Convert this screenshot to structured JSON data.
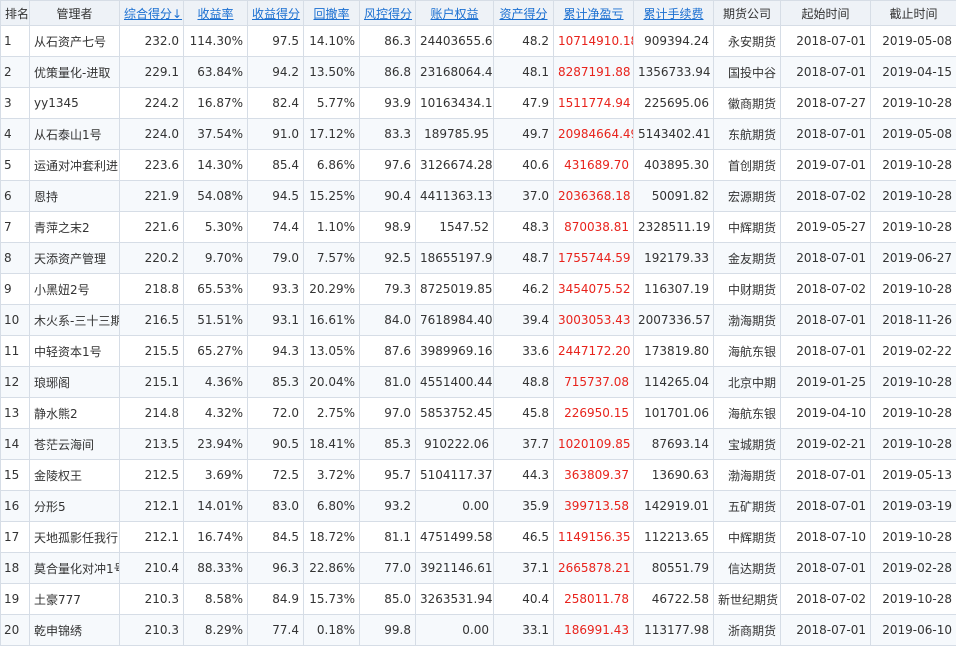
{
  "table": {
    "headers": [
      "排名",
      "管理者",
      "综合得分↓",
      "收益率",
      "收益得分",
      "回撤率",
      "风控得分",
      "账户权益",
      "资产得分",
      "累计净盈亏",
      "累计手续费",
      "期货公司",
      "起始时间",
      "截止时间"
    ],
    "rows": [
      {
        "rank": "1",
        "manager": "从石资产七号",
        "score": "232.0",
        "return_rate": "114.30%",
        "return_score": "97.5",
        "drawdown": "14.10%",
        "risk_score": "86.3",
        "equity": "24403655.63",
        "asset_score": "48.2",
        "net_pnl": "10714910.18",
        "fees": "909394.24",
        "broker": "永安期货",
        "start": "2018-07-01",
        "end": "2019-05-08"
      },
      {
        "rank": "2",
        "manager": "优策量化-进取",
        "score": "229.1",
        "return_rate": "63.84%",
        "return_score": "94.2",
        "drawdown": "13.50%",
        "risk_score": "86.8",
        "equity": "23168064.49",
        "asset_score": "48.1",
        "net_pnl": "8287191.88",
        "fees": "1356733.94",
        "broker": "国投中谷",
        "start": "2018-07-01",
        "end": "2019-04-15"
      },
      {
        "rank": "3",
        "manager": "yy1345",
        "score": "224.2",
        "return_rate": "16.87%",
        "return_score": "82.4",
        "drawdown": "5.77%",
        "risk_score": "93.9",
        "equity": "10163434.19",
        "asset_score": "47.9",
        "net_pnl": "1511774.94",
        "fees": "225695.06",
        "broker": "徽商期货",
        "start": "2018-07-27",
        "end": "2019-10-28"
      },
      {
        "rank": "4",
        "manager": "从石泰山1号",
        "score": "224.0",
        "return_rate": "37.54%",
        "return_score": "91.0",
        "drawdown": "17.12%",
        "risk_score": "83.3",
        "equity": "189785.95",
        "asset_score": "49.7",
        "net_pnl": "20984664.49",
        "fees": "5143402.41",
        "broker": "东航期货",
        "start": "2018-07-01",
        "end": "2019-05-08"
      },
      {
        "rank": "5",
        "manager": "运通对冲套利进",
        "score": "223.6",
        "return_rate": "14.30%",
        "return_score": "85.4",
        "drawdown": "6.86%",
        "risk_score": "97.6",
        "equity": "3126674.28",
        "asset_score": "40.6",
        "net_pnl": "431689.70",
        "fees": "403895.30",
        "broker": "首创期货",
        "start": "2019-07-01",
        "end": "2019-10-28"
      },
      {
        "rank": "6",
        "manager": "恩持",
        "score": "221.9",
        "return_rate": "54.08%",
        "return_score": "94.5",
        "drawdown": "15.25%",
        "risk_score": "90.4",
        "equity": "4411363.13",
        "asset_score": "37.0",
        "net_pnl": "2036368.18",
        "fees": "50091.82",
        "broker": "宏源期货",
        "start": "2018-07-02",
        "end": "2019-10-28"
      },
      {
        "rank": "7",
        "manager": "青萍之末2",
        "score": "221.6",
        "return_rate": "5.30%",
        "return_score": "74.4",
        "drawdown": "1.10%",
        "risk_score": "98.9",
        "equity": "1547.52",
        "asset_score": "48.3",
        "net_pnl": "870038.81",
        "fees": "2328511.19",
        "broker": "中辉期货",
        "start": "2019-05-27",
        "end": "2019-10-28"
      },
      {
        "rank": "8",
        "manager": "天添资产管理",
        "score": "220.2",
        "return_rate": "9.70%",
        "return_score": "79.0",
        "drawdown": "7.57%",
        "risk_score": "92.5",
        "equity": "18655197.95",
        "asset_score": "48.7",
        "net_pnl": "1755744.59",
        "fees": "192179.33",
        "broker": "金友期货",
        "start": "2018-07-01",
        "end": "2019-06-27"
      },
      {
        "rank": "9",
        "manager": "小黑妞2号",
        "score": "218.8",
        "return_rate": "65.53%",
        "return_score": "93.3",
        "drawdown": "20.29%",
        "risk_score": "79.3",
        "equity": "8725019.85",
        "asset_score": "46.2",
        "net_pnl": "3454075.52",
        "fees": "116307.19",
        "broker": "中财期货",
        "start": "2018-07-02",
        "end": "2019-10-28"
      },
      {
        "rank": "10",
        "manager": "木火系-三十三期",
        "score": "216.5",
        "return_rate": "51.51%",
        "return_score": "93.1",
        "drawdown": "16.61%",
        "risk_score": "84.0",
        "equity": "7618984.40",
        "asset_score": "39.4",
        "net_pnl": "3003053.43",
        "fees": "2007336.57",
        "broker": "渤海期货",
        "start": "2018-07-01",
        "end": "2018-11-26"
      },
      {
        "rank": "11",
        "manager": "中轻资本1号",
        "score": "215.5",
        "return_rate": "65.27%",
        "return_score": "94.3",
        "drawdown": "13.05%",
        "risk_score": "87.6",
        "equity": "3989969.16",
        "asset_score": "33.6",
        "net_pnl": "2447172.20",
        "fees": "173819.80",
        "broker": "海航东银",
        "start": "2018-07-01",
        "end": "2019-02-22"
      },
      {
        "rank": "12",
        "manager": "琅琊阁",
        "score": "215.1",
        "return_rate": "4.36%",
        "return_score": "85.3",
        "drawdown": "20.04%",
        "risk_score": "81.0",
        "equity": "4551400.44",
        "asset_score": "48.8",
        "net_pnl": "715737.08",
        "fees": "114265.04",
        "broker": "北京中期",
        "start": "2019-01-25",
        "end": "2019-10-28"
      },
      {
        "rank": "13",
        "manager": "静水熊2",
        "score": "214.8",
        "return_rate": "4.32%",
        "return_score": "72.0",
        "drawdown": "2.75%",
        "risk_score": "97.0",
        "equity": "5853752.45",
        "asset_score": "45.8",
        "net_pnl": "226950.15",
        "fees": "101701.06",
        "broker": "海航东银",
        "start": "2019-04-10",
        "end": "2019-10-28"
      },
      {
        "rank": "14",
        "manager": "苍茫云海间",
        "score": "213.5",
        "return_rate": "23.94%",
        "return_score": "90.5",
        "drawdown": "18.41%",
        "risk_score": "85.3",
        "equity": "910222.06",
        "asset_score": "37.7",
        "net_pnl": "1020109.85",
        "fees": "87693.14",
        "broker": "宝城期货",
        "start": "2019-02-21",
        "end": "2019-10-28"
      },
      {
        "rank": "15",
        "manager": "金陵权王",
        "score": "212.5",
        "return_rate": "3.69%",
        "return_score": "72.5",
        "drawdown": "3.72%",
        "risk_score": "95.7",
        "equity": "5104117.37",
        "asset_score": "44.3",
        "net_pnl": "363809.37",
        "fees": "13690.63",
        "broker": "渤海期货",
        "start": "2018-07-01",
        "end": "2019-05-13"
      },
      {
        "rank": "16",
        "manager": "分形5",
        "score": "212.1",
        "return_rate": "14.01%",
        "return_score": "83.0",
        "drawdown": "6.80%",
        "risk_score": "93.2",
        "equity": "0.00",
        "asset_score": "35.9",
        "net_pnl": "399713.58",
        "fees": "142919.01",
        "broker": "五矿期货",
        "start": "2018-07-01",
        "end": "2019-03-19"
      },
      {
        "rank": "17",
        "manager": "天地孤影任我行",
        "score": "212.1",
        "return_rate": "16.74%",
        "return_score": "84.5",
        "drawdown": "18.72%",
        "risk_score": "81.1",
        "equity": "4751499.58",
        "asset_score": "46.5",
        "net_pnl": "1149156.35",
        "fees": "112213.65",
        "broker": "中辉期货",
        "start": "2018-07-10",
        "end": "2019-10-28"
      },
      {
        "rank": "18",
        "manager": "莫合量化对冲1号",
        "score": "210.4",
        "return_rate": "88.33%",
        "return_score": "96.3",
        "drawdown": "22.86%",
        "risk_score": "77.0",
        "equity": "3921146.61",
        "asset_score": "37.1",
        "net_pnl": "2665878.21",
        "fees": "80551.79",
        "broker": "信达期货",
        "start": "2018-07-01",
        "end": "2019-02-28"
      },
      {
        "rank": "19",
        "manager": "土豪777",
        "score": "210.3",
        "return_rate": "8.58%",
        "return_score": "84.9",
        "drawdown": "15.73%",
        "risk_score": "85.0",
        "equity": "3263531.94",
        "asset_score": "40.4",
        "net_pnl": "258011.78",
        "fees": "46722.58",
        "broker": "新世纪期货",
        "start": "2018-07-02",
        "end": "2019-10-28"
      },
      {
        "rank": "20",
        "manager": "乾申锦绣",
        "score": "210.3",
        "return_rate": "8.29%",
        "return_score": "77.4",
        "drawdown": "0.18%",
        "risk_score": "99.8",
        "equity": "0.00",
        "asset_score": "33.1",
        "net_pnl": "186991.43",
        "fees": "113177.98",
        "broker": "浙商期货",
        "start": "2018-07-01",
        "end": "2019-06-10"
      }
    ]
  }
}
